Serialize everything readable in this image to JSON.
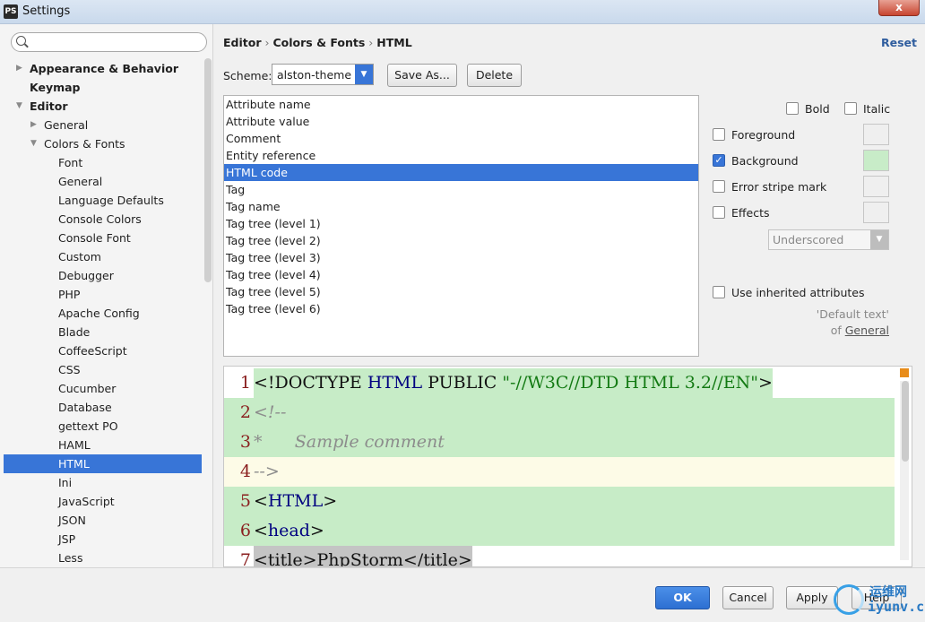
{
  "window": {
    "title": "Settings",
    "app_icon": "phpstorm-icon",
    "close_label": "x"
  },
  "search": {
    "placeholder": ""
  },
  "tree": [
    {
      "label": "Appearance & Behavior",
      "level": 0,
      "bold": true,
      "arrow": "collapsed"
    },
    {
      "label": "Keymap",
      "level": 0,
      "bold": true,
      "arrow": "none"
    },
    {
      "label": "Editor",
      "level": 0,
      "bold": true,
      "arrow": "expanded"
    },
    {
      "label": "General",
      "level": 1,
      "bold": false,
      "arrow": "collapsed"
    },
    {
      "label": "Colors & Fonts",
      "level": 1,
      "bold": false,
      "arrow": "expanded"
    },
    {
      "label": "Font",
      "level": 2
    },
    {
      "label": "General",
      "level": 2
    },
    {
      "label": "Language Defaults",
      "level": 2
    },
    {
      "label": "Console Colors",
      "level": 2
    },
    {
      "label": "Console Font",
      "level": 2
    },
    {
      "label": "Custom",
      "level": 2
    },
    {
      "label": "Debugger",
      "level": 2
    },
    {
      "label": "PHP",
      "level": 2
    },
    {
      "label": "Apache Config",
      "level": 2
    },
    {
      "label": "Blade",
      "level": 2
    },
    {
      "label": "CoffeeScript",
      "level": 2
    },
    {
      "label": "CSS",
      "level": 2
    },
    {
      "label": "Cucumber",
      "level": 2
    },
    {
      "label": "Database",
      "level": 2
    },
    {
      "label": "gettext PO",
      "level": 2
    },
    {
      "label": "HAML",
      "level": 2
    },
    {
      "label": "HTML",
      "level": 2,
      "selected": true
    },
    {
      "label": "Ini",
      "level": 2
    },
    {
      "label": "JavaScript",
      "level": 2
    },
    {
      "label": "JSON",
      "level": 2
    },
    {
      "label": "JSP",
      "level": 2
    },
    {
      "label": "Less",
      "level": 2
    }
  ],
  "breadcrumb": {
    "part1": "Editor",
    "part2": "Colors & Fonts",
    "part3": "HTML",
    "sep": "›"
  },
  "reset_label": "Reset",
  "scheme": {
    "label": "Scheme:",
    "value": "alston-theme",
    "save_as": "Save As...",
    "delete": "Delete"
  },
  "attributes": [
    "Attribute name",
    "Attribute value",
    "Comment",
    "Entity reference",
    "HTML code",
    "Tag",
    "Tag name",
    "Tag tree (level 1)",
    "Tag tree (level 2)",
    "Tag tree (level 3)",
    "Tag tree (level 4)",
    "Tag tree (level 5)",
    "Tag tree (level 6)"
  ],
  "selected_attribute": "HTML code",
  "options": {
    "bold": "Bold",
    "italic": "Italic",
    "foreground": "Foreground",
    "background": "Background",
    "error_stripe": "Error stripe mark",
    "effects": "Effects",
    "effects_type": "Underscored",
    "use_inherited": "Use inherited attributes",
    "inherit_note1": "'Default text'",
    "inherit_note2": "of",
    "inherit_link": "General",
    "background_checked": true,
    "background_color": "#c8ecc8"
  },
  "preview": {
    "line_bg": "#c7ecc7",
    "caret_line_bg": "#fdfbe7",
    "lines": [
      {
        "n": "1",
        "parts": [
          [
            "plain",
            "<!DOCTYPE "
          ],
          [
            "tag",
            "HTML "
          ],
          [
            "plain",
            "PUBLIC "
          ],
          [
            "str",
            "\"-//W3C//DTD HTML 3.2//EN\""
          ],
          [
            "plain",
            ">"
          ]
        ],
        "bg": "white"
      },
      {
        "n": "2",
        "parts": [
          [
            "cmt",
            "<!--"
          ]
        ],
        "bg": "green"
      },
      {
        "n": "3",
        "parts": [
          [
            "cmt",
            "*      Sample comment"
          ]
        ],
        "bg": "green"
      },
      {
        "n": "4",
        "parts": [
          [
            "cmt",
            "-->"
          ]
        ],
        "bg": "caret"
      },
      {
        "n": "5",
        "parts": [
          [
            "plain",
            "<"
          ],
          [
            "tag",
            "HTML"
          ],
          [
            "plain",
            ">"
          ]
        ],
        "bg": "green"
      },
      {
        "n": "6",
        "parts": [
          [
            "plain",
            "<"
          ],
          [
            "tag",
            "head"
          ],
          [
            "plain",
            ">"
          ]
        ],
        "bg": "green"
      },
      {
        "n": "7",
        "parts": [
          [
            "plain",
            "<title>PhpStorm</title>"
          ]
        ],
        "bg": "gray"
      }
    ]
  },
  "buttons": {
    "ok": "OK",
    "cancel": "Cancel",
    "apply": "Apply",
    "help": "Help"
  },
  "watermark": {
    "line1": "运维网",
    "line2": "iyunv.com"
  }
}
